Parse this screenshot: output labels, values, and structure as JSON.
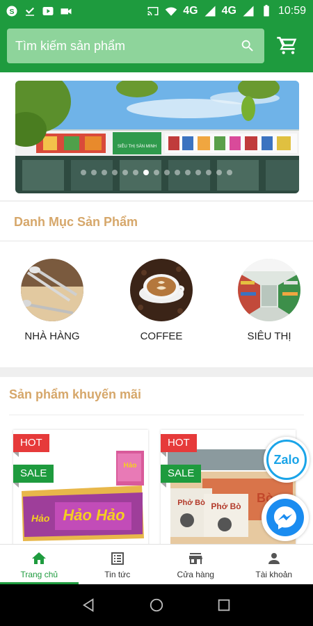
{
  "status_bar": {
    "network_1": "4G",
    "network_2": "4G",
    "time": "10:59",
    "icons": [
      "skype-icon",
      "download-icon",
      "youtube-icon",
      "video-camera-icon",
      "cast-icon",
      "wifi-icon",
      "signal-icon",
      "battery-icon"
    ]
  },
  "search": {
    "placeholder": "Tìm kiếm sản phẩm"
  },
  "banner": {
    "store_sign": "SIÊU THỊ SÀN MINH",
    "slide_count": 15,
    "active_slide": 6
  },
  "categories": {
    "title": "Danh Mục Sản Phẩm",
    "items": [
      {
        "label": "NHÀ HÀNG",
        "icon": "restaurant-cutlery-image"
      },
      {
        "label": "COFFEE",
        "icon": "coffee-cup-image"
      },
      {
        "label": "SIÊU THỊ",
        "icon": "supermarket-aisle-image"
      }
    ]
  },
  "promo": {
    "title": "Sản phẩm khuyến mãi",
    "products": [
      {
        "tags": [
          "HOT",
          "SALE"
        ],
        "brand_text": "Hảo Hảo"
      },
      {
        "tags": [
          "HOT",
          "SALE"
        ],
        "brand_text": "Phở Bò"
      }
    ]
  },
  "floating": {
    "zalo_label": "Zalo"
  },
  "bottom_nav": {
    "items": [
      {
        "label": "Trang chủ",
        "icon": "home-icon",
        "active": true
      },
      {
        "label": "Tin tức",
        "icon": "news-icon",
        "active": false
      },
      {
        "label": "Cửa hàng",
        "icon": "store-icon",
        "active": false
      },
      {
        "label": "Tài khoản",
        "icon": "account-icon",
        "active": false
      }
    ]
  },
  "colors": {
    "primary_green": "#1e9b3e",
    "section_title": "#d6a76a",
    "hot_tag": "#e63a3a",
    "zalo_blue": "#1aa4e8"
  }
}
